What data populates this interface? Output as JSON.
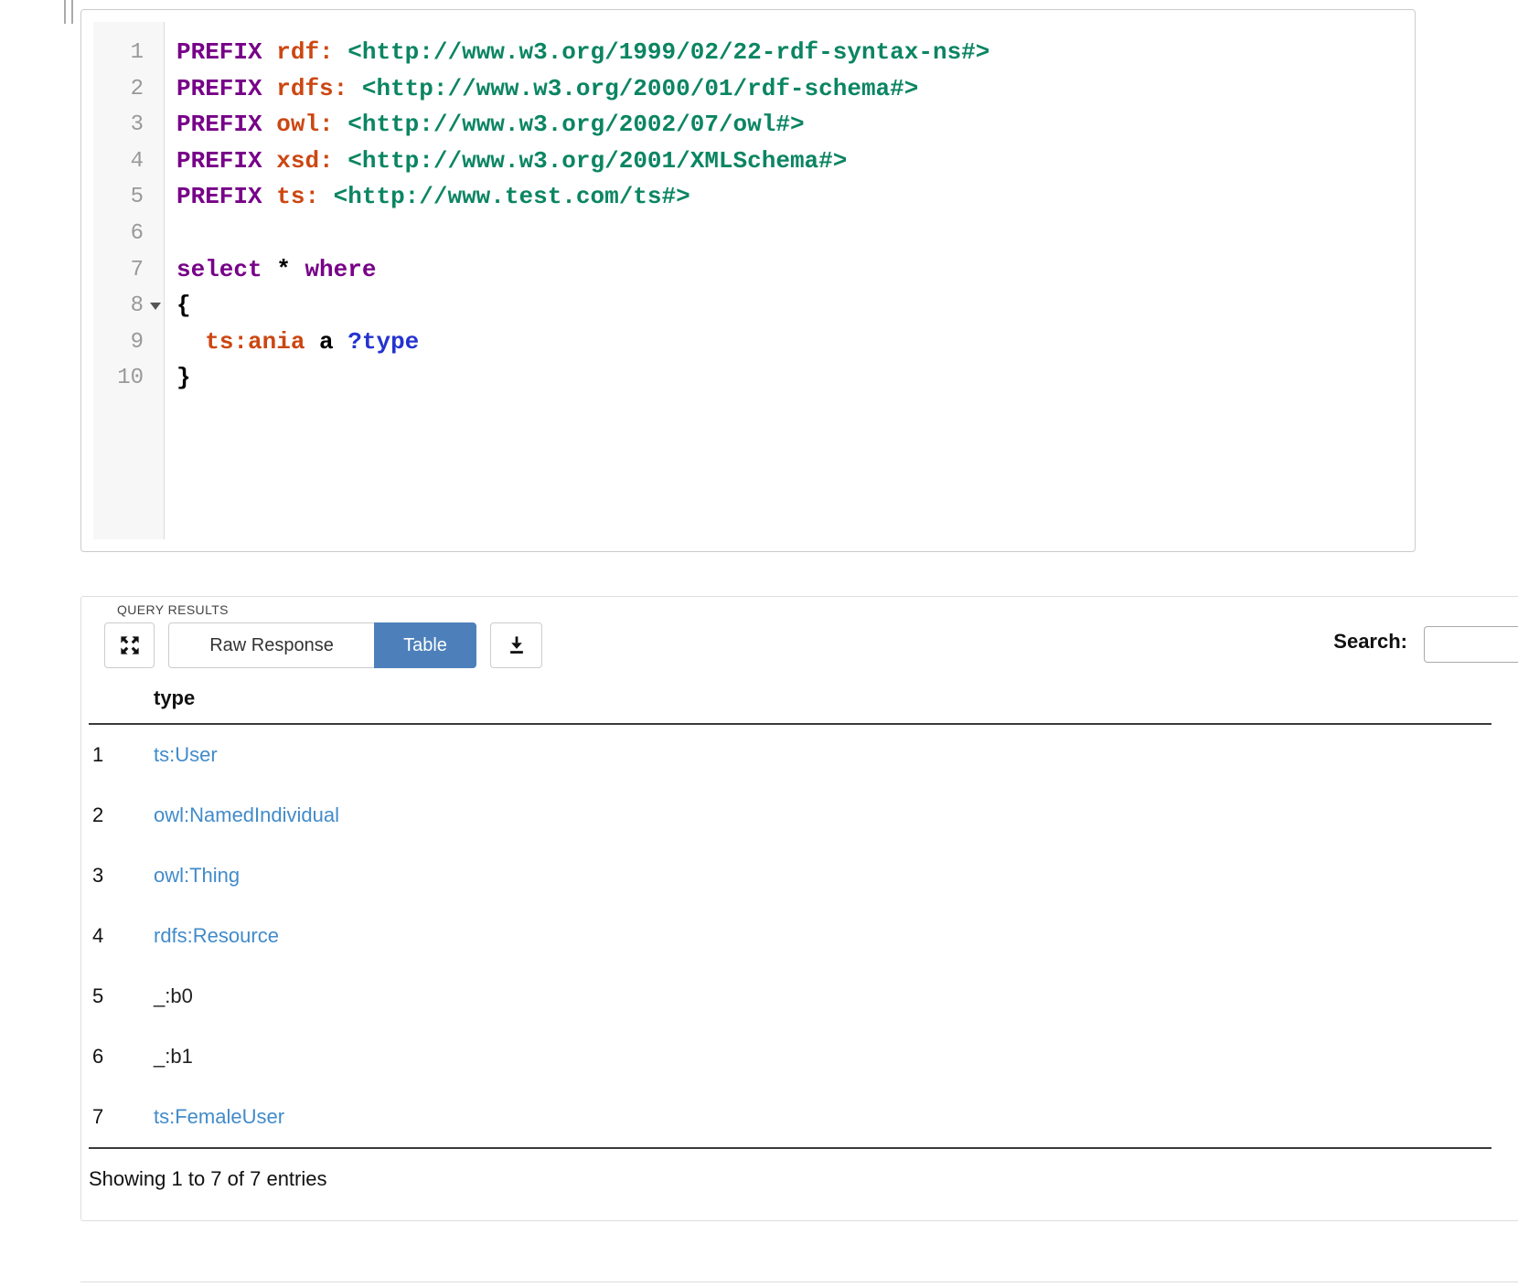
{
  "colors": {
    "keyword": "#770088",
    "prefixed": "#cc4712",
    "uri": "#0b8562",
    "variable": "#2433d0",
    "link": "#428bca",
    "active_tab_bg": "#4d80bb"
  },
  "editor": {
    "lines": [
      {
        "num": "1",
        "fold": false,
        "tokens": [
          {
            "t": "PREFIX",
            "c": "kw"
          },
          {
            "t": " ",
            "c": "pl"
          },
          {
            "t": "rdf:",
            "c": "pre"
          },
          {
            "t": " ",
            "c": "pl"
          },
          {
            "t": "<http://www.w3.org/1999/02/22-rdf-syntax-ns#>",
            "c": "uri"
          }
        ]
      },
      {
        "num": "2",
        "fold": false,
        "tokens": [
          {
            "t": "PREFIX",
            "c": "kw"
          },
          {
            "t": " ",
            "c": "pl"
          },
          {
            "t": "rdfs:",
            "c": "pre"
          },
          {
            "t": " ",
            "c": "pl"
          },
          {
            "t": "<http://www.w3.org/2000/01/rdf-schema#>",
            "c": "uri"
          }
        ]
      },
      {
        "num": "3",
        "fold": false,
        "tokens": [
          {
            "t": "PREFIX",
            "c": "kw"
          },
          {
            "t": " ",
            "c": "pl"
          },
          {
            "t": "owl:",
            "c": "pre"
          },
          {
            "t": " ",
            "c": "pl"
          },
          {
            "t": "<http://www.w3.org/2002/07/owl#>",
            "c": "uri"
          }
        ]
      },
      {
        "num": "4",
        "fold": false,
        "tokens": [
          {
            "t": "PREFIX",
            "c": "kw"
          },
          {
            "t": " ",
            "c": "pl"
          },
          {
            "t": "xsd:",
            "c": "pre"
          },
          {
            "t": " ",
            "c": "pl"
          },
          {
            "t": "<http://www.w3.org/2001/XMLSchema#>",
            "c": "uri"
          }
        ]
      },
      {
        "num": "5",
        "fold": false,
        "tokens": [
          {
            "t": "PREFIX",
            "c": "kw"
          },
          {
            "t": " ",
            "c": "pl"
          },
          {
            "t": "ts:",
            "c": "pre"
          },
          {
            "t": " ",
            "c": "pl"
          },
          {
            "t": "<http://www.test.com/ts#>",
            "c": "uri"
          }
        ]
      },
      {
        "num": "6",
        "fold": false,
        "tokens": []
      },
      {
        "num": "7",
        "fold": false,
        "tokens": [
          {
            "t": "select",
            "c": "kw"
          },
          {
            "t": " * ",
            "c": "pl"
          },
          {
            "t": "where",
            "c": "kw"
          }
        ]
      },
      {
        "num": "8",
        "fold": true,
        "tokens": [
          {
            "t": "{",
            "c": "pl"
          }
        ]
      },
      {
        "num": "9",
        "fold": false,
        "tokens": [
          {
            "t": "  ",
            "c": "pl"
          },
          {
            "t": "ts:ania",
            "c": "pre"
          },
          {
            "t": " ",
            "c": "pl"
          },
          {
            "t": "a",
            "c": "pl"
          },
          {
            "t": " ",
            "c": "pl"
          },
          {
            "t": "?type",
            "c": "var"
          }
        ]
      },
      {
        "num": "10",
        "fold": false,
        "tokens": [
          {
            "t": "}",
            "c": "pl"
          }
        ]
      }
    ]
  },
  "results": {
    "section_label": "QUERY RESULTS",
    "toolbar": {
      "fullscreen_icon": "fullscreen-expand",
      "raw_response_label": "Raw Response",
      "table_label": "Table",
      "download_icon": "download",
      "search_label": "Search:",
      "search_value": ""
    },
    "table": {
      "header": "type",
      "rows": [
        {
          "num": "1",
          "value": "ts:User",
          "link": true
        },
        {
          "num": "2",
          "value": "owl:NamedIndividual",
          "link": true
        },
        {
          "num": "3",
          "value": "owl:Thing",
          "link": true
        },
        {
          "num": "4",
          "value": "rdfs:Resource",
          "link": true
        },
        {
          "num": "5",
          "value": "_:b0",
          "link": false
        },
        {
          "num": "6",
          "value": "_:b1",
          "link": false
        },
        {
          "num": "7",
          "value": "ts:FemaleUser",
          "link": true
        }
      ]
    },
    "footer": "Showing 1 to 7 of 7 entries"
  }
}
